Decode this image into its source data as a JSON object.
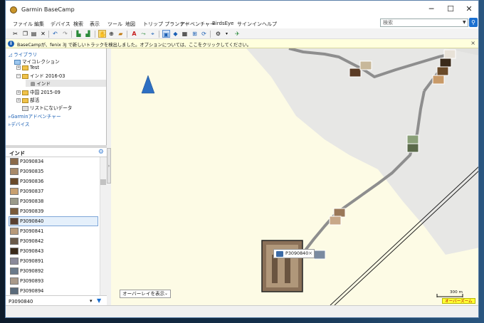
{
  "app": {
    "title": "Garmin BaseCamp",
    "minimize": "─",
    "maximize": "☐",
    "close": "✕"
  },
  "menu": [
    "ファイル",
    "編集",
    "デバイス",
    "検索",
    "表示",
    "ツール",
    "地図",
    "トリップ プランナー",
    "アドベンチャー",
    "BirdsEye",
    "サインイン",
    "ヘルプ"
  ],
  "search": {
    "placeholder": "検索"
  },
  "toolbar_icons": [
    "cut-icon",
    "copy-icon",
    "paste-icon",
    "delete-icon",
    "undo-icon",
    "redo-icon",
    "receive-icon",
    "send-icon",
    "hand-icon",
    "zoom-icon",
    "measure-icon",
    "route-icon",
    "track-icon",
    "waypoint-icon",
    "map-2d-icon",
    "map-3d-icon",
    "photo-view-icon",
    "globe-icon",
    "refresh-icon",
    "settings-icon",
    "dropdown-icon",
    "new-icon"
  ],
  "info": {
    "text": "BaseCampが、fenix 3J で新しいトラックを検出しました。オプションについては、ここをクリックしてください。",
    "close": "×"
  },
  "library": {
    "root": "ライブラリ",
    "my_collection": "マイコレクション",
    "items": [
      "Test",
      "インド 2016-03",
      "インド",
      "中国 2015-09",
      "部活",
      "リストにないデータ"
    ],
    "adventures": "Garminアドベンチャー",
    "devices": "デバイス"
  },
  "panel": {
    "title": "インド"
  },
  "photos": [
    "P3090834",
    "P3090835",
    "P3090836",
    "P3090837",
    "P3090838",
    "P3090839",
    "P3090840",
    "P3090841",
    "P3090842",
    "P3090843",
    "P3090891",
    "P3090892",
    "P3090893",
    "P3090894"
  ],
  "selected_photo_index": 6,
  "bottom": {
    "value": "P3090840",
    "dropdown": "▾",
    "filter": "▼"
  },
  "map": {
    "overlay_label": "オーバーレイを表示",
    "overlay_dd": "⌄",
    "scale": "300 m",
    "zoom_label": "オーバーズーム",
    "popup_label": "P3090840",
    "popup_close": "×"
  },
  "colors": {
    "map_bg": "#fdfbe5",
    "map_gray": "#e7e7e5",
    "track": "#8e8e8e",
    "accent": "#1a6fd0"
  }
}
